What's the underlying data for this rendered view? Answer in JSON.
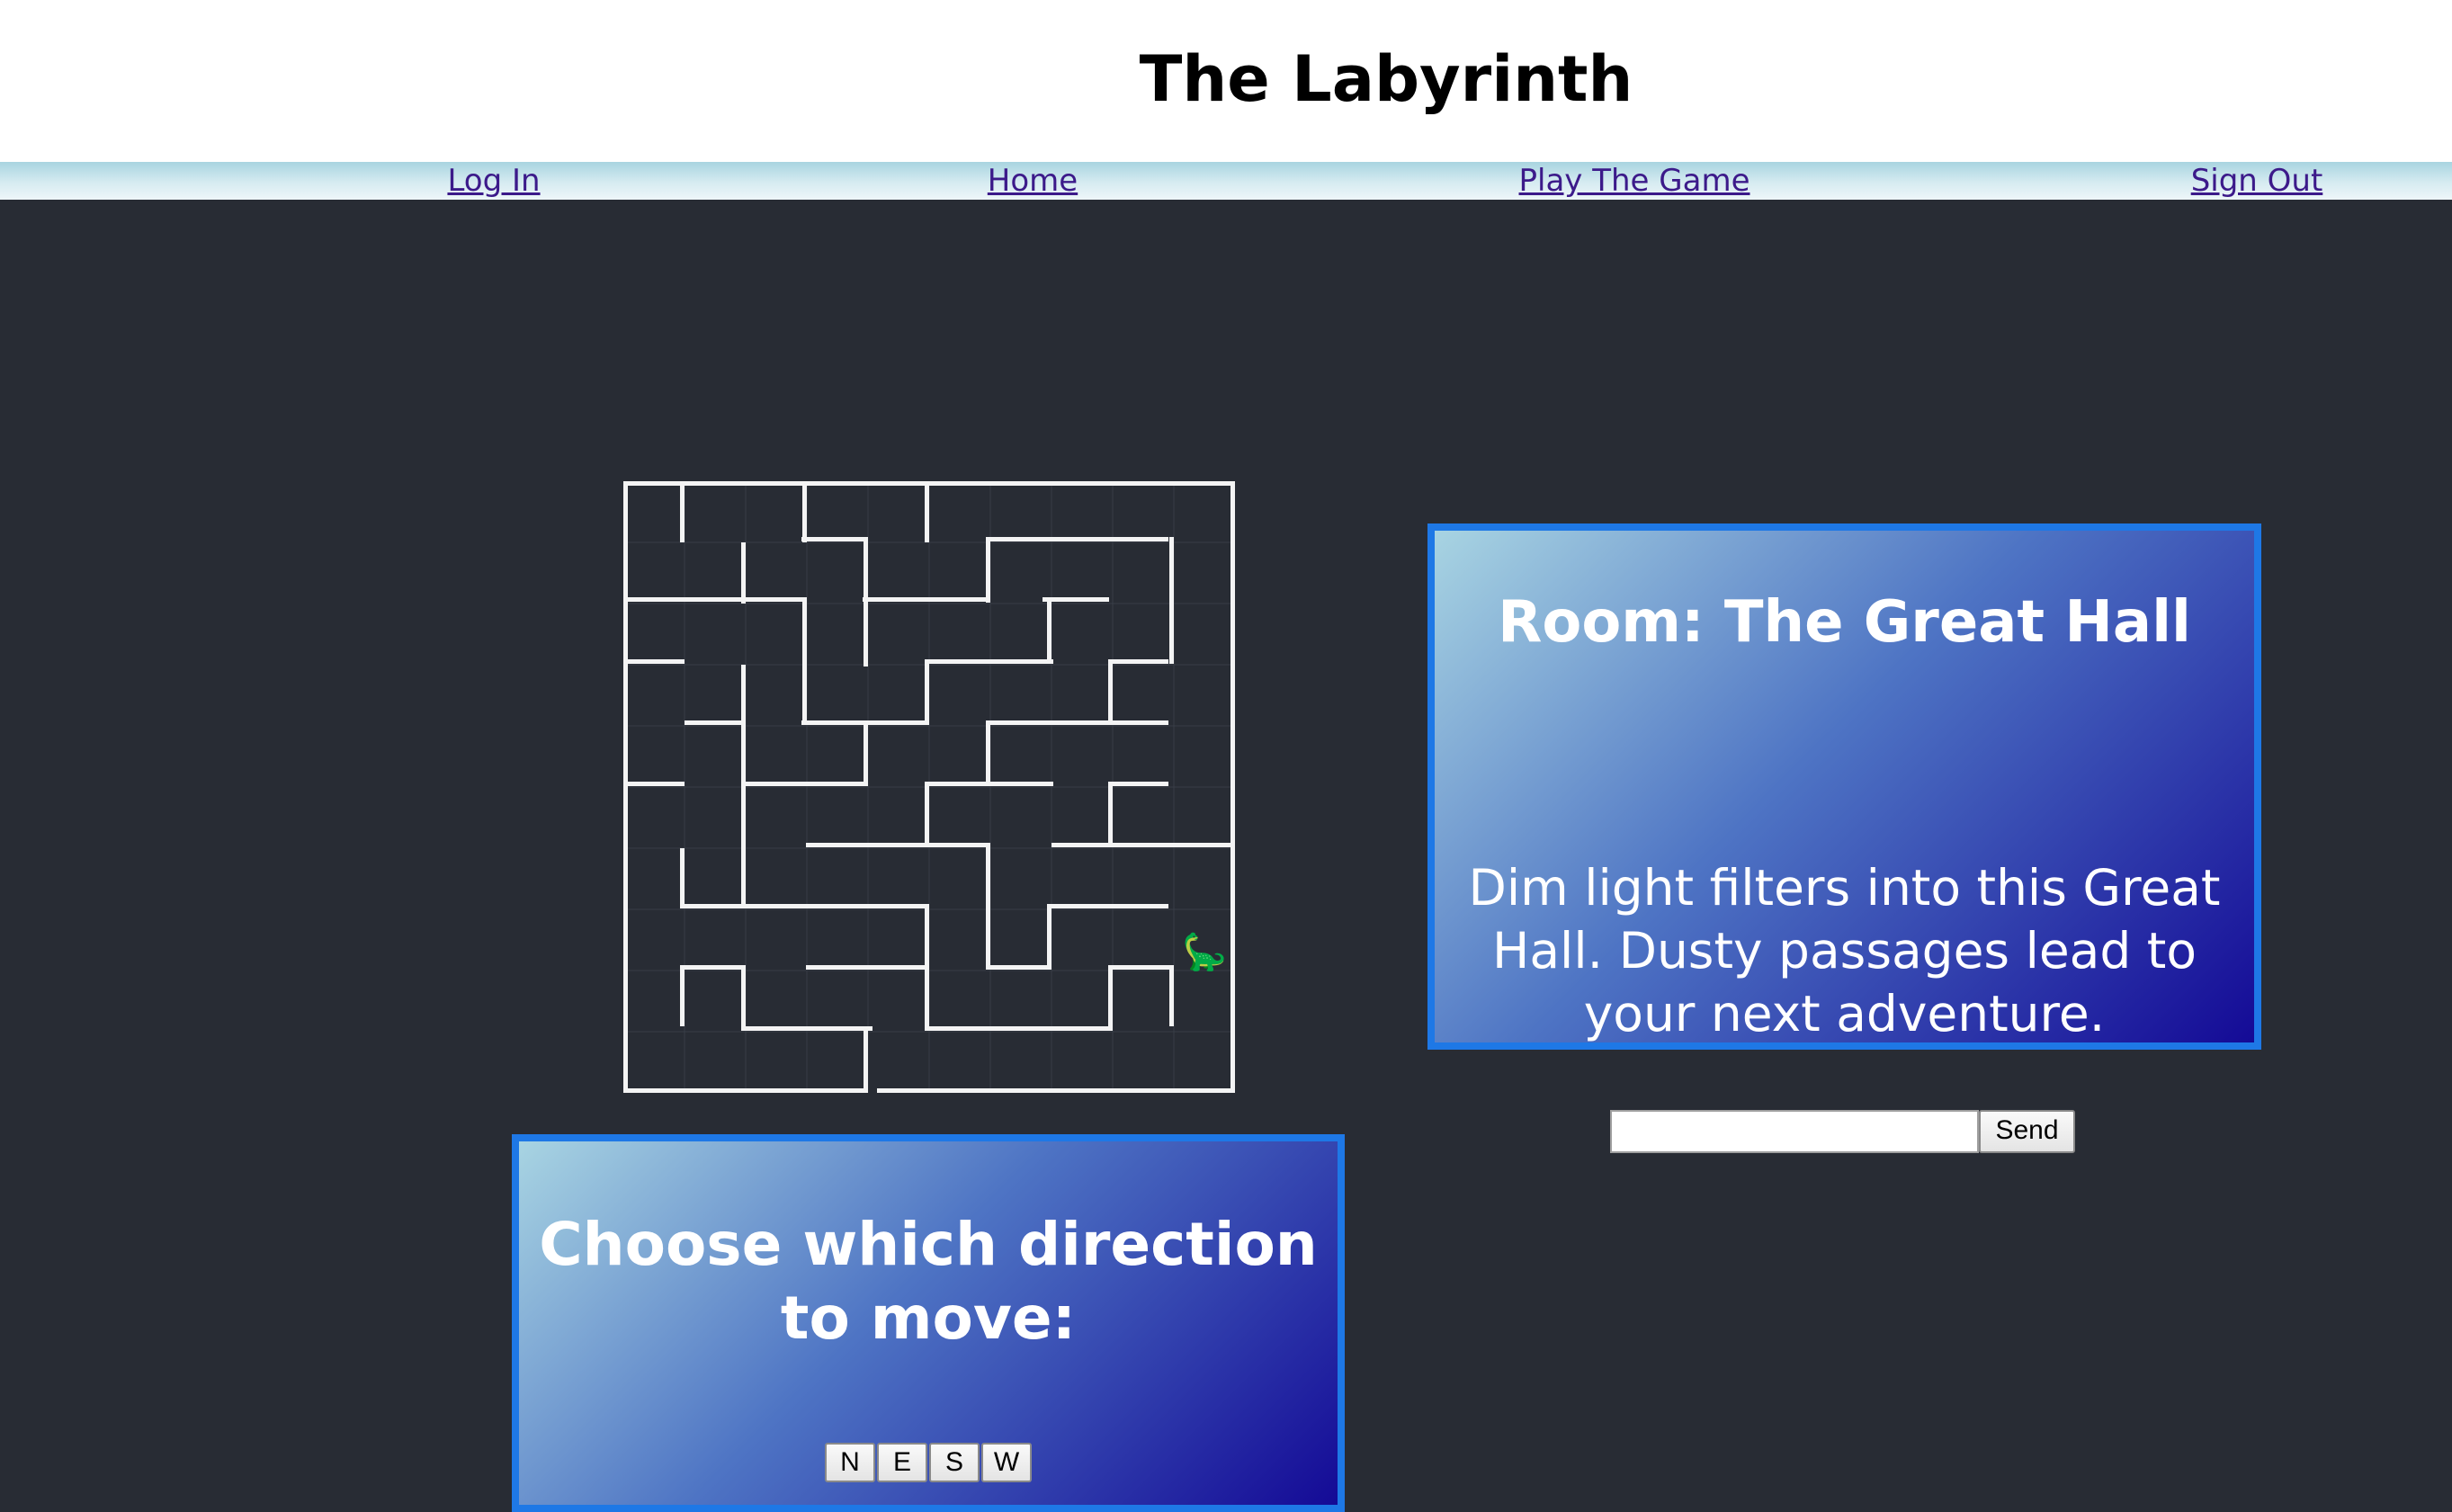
{
  "header": {
    "title": "The Labyrinth"
  },
  "nav": {
    "links": [
      {
        "label": "Log In"
      },
      {
        "label": "Home"
      },
      {
        "label": "Play The Game"
      },
      {
        "label": "Sign Out"
      }
    ]
  },
  "maze": {
    "columns": 10,
    "rows": 10,
    "wall_color": "#f4f4f4",
    "background_color": "#282c34",
    "player_icon": "dinosaur-icon",
    "player_glyph": "🦕",
    "player_cell": {
      "col": 9,
      "row": 7
    }
  },
  "room": {
    "title": "Room: The Great Hall",
    "description": "Dim light filters into this Great Hall. Dusty passages lead to your next adventure."
  },
  "chat": {
    "input_value": "",
    "send_label": "Send"
  },
  "movement": {
    "prompt": "Choose which direction to move:",
    "buttons": [
      {
        "label": "N"
      },
      {
        "label": "E"
      },
      {
        "label": "S"
      },
      {
        "label": "W"
      }
    ]
  },
  "colors": {
    "page_background": "#282c34",
    "panel_border": "#1e78e6",
    "panel_gradient_start": "#a8d4e2",
    "panel_gradient_end": "#140a96",
    "nav_link": "#3c1a8a"
  }
}
